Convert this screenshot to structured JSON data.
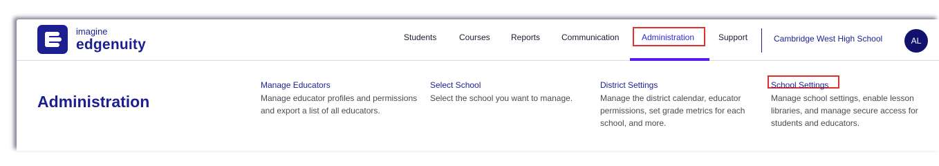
{
  "brand": {
    "line1": "imagine",
    "line2": "edgenuity"
  },
  "nav": {
    "items": [
      {
        "label": "Students"
      },
      {
        "label": "Courses"
      },
      {
        "label": "Reports"
      },
      {
        "label": "Communication"
      },
      {
        "label": "Administration",
        "active": true
      },
      {
        "label": "Support"
      }
    ],
    "school": "Cambridge West High School",
    "avatar": "AL"
  },
  "page": {
    "title": "Administration"
  },
  "cards": [
    {
      "title": "Manage Educators",
      "description": "Manage educator profiles and permissions and export a list of all educators."
    },
    {
      "title": "Select School",
      "description": "Select the school you want to manage."
    },
    {
      "title": "District Settings",
      "description": "Manage the district calendar, educator permissions, set grade metrics for each school, and more."
    },
    {
      "title": "School Settings",
      "description": "Manage school settings, enable lesson libraries, and manage secure access for students and educators."
    }
  ],
  "colors": {
    "brand": "#1b1f8f",
    "active_underline": "#5a19f0",
    "highlight": "#e0312e",
    "avatar_bg": "#12126e"
  },
  "icons": {
    "logo": "edgenuity-logo-icon"
  }
}
